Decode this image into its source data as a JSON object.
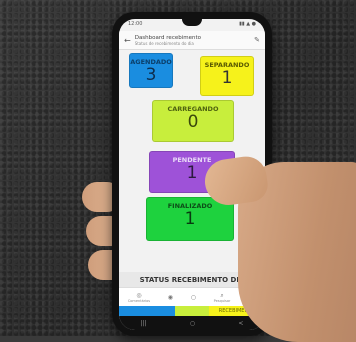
{
  "statusbar": {
    "time": "12:00",
    "icons": "▮▮ ▲ ●"
  },
  "appbar": {
    "back_icon": "←",
    "title": "Dashboard recebimento",
    "subtitle": "Status de recebimento do dia",
    "edit_icon": "✎"
  },
  "cards": {
    "agendado": {
      "label": "AGENDADO",
      "value": "3"
    },
    "separando": {
      "label": "SEPARANDO",
      "value": "1"
    },
    "carregando": {
      "label": "CARREGANDO",
      "value": "0"
    },
    "pendente": {
      "label": "PENDENTE",
      "value": "1"
    },
    "finalizado": {
      "label": "FINALIZADO",
      "value": "1"
    }
  },
  "section": {
    "title": "STATUS RECEBIMENTO DIA"
  },
  "nav": {
    "items": [
      {
        "icon": "◎",
        "label": "Comentários"
      },
      {
        "icon": "◉",
        "label": ""
      },
      {
        "icon": "○",
        "label": ""
      },
      {
        "icon": "⌕",
        "label": "Pesquisar"
      },
      {
        "icon": "≡",
        "label": "Mais"
      }
    ]
  },
  "bottom_strip": {
    "label": "RECEBIMENTO"
  },
  "sysnav": {
    "left": "|||",
    "home": "○",
    "back": "<"
  },
  "colors": {
    "agendado": "#1a8de0",
    "separando": "#f6f21b",
    "carregando": "#c8ee3c",
    "pendente": "#9e52d8",
    "finalizado": "#1ed23e"
  }
}
